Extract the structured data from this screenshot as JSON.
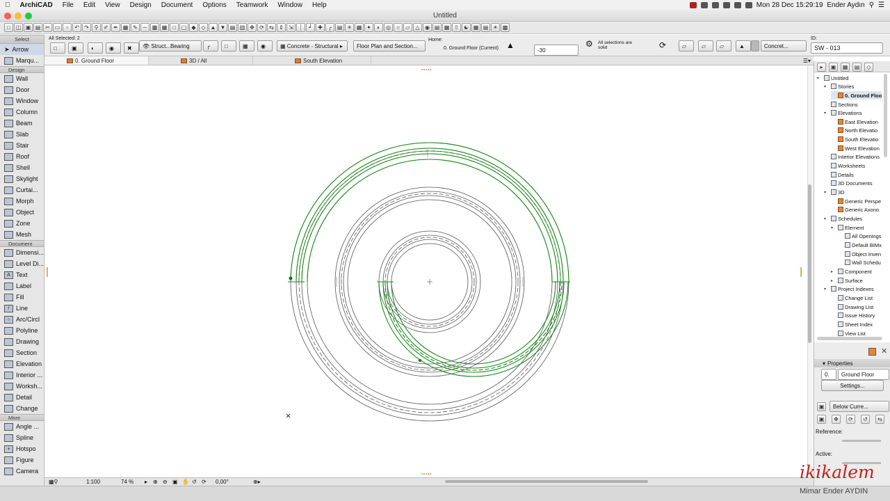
{
  "menubar": {
    "app": "ArchiCAD",
    "items": [
      "File",
      "Edit",
      "View",
      "Design",
      "Document",
      "Options",
      "Teamwork",
      "Window",
      "Help"
    ],
    "datetime": "Mon 28 Dec  15:29:19",
    "user": "Ender Aydın"
  },
  "window": {
    "title": "Untitled"
  },
  "infobox": {
    "selection": "All Selected: 2",
    "structure": "Struct...Bearing",
    "material": "Concrete - Structural",
    "display": "Floor Plan and Section...",
    "home_label": "Home:",
    "home_story": "0. Ground Floor (Current)",
    "offset": "-30",
    "solid_note": "All selections are solid",
    "fill_name": "Concret...",
    "id_label": "ID:",
    "id_value": "SW - 013"
  },
  "tabs": [
    "0. Ground Floor",
    "3D / All",
    "South Elevation"
  ],
  "toolbox": {
    "select_header": "Select",
    "select_tools": [
      "Arrow",
      "Marqu..."
    ],
    "design_header": "Design",
    "design_tools": [
      "Wall",
      "Door",
      "Window",
      "Column",
      "Beam",
      "Slab",
      "Stair",
      "Roof",
      "Shell",
      "Skylight",
      "Curtai...",
      "Morph",
      "Object",
      "Zone",
      "Mesh"
    ],
    "document_header": "Document",
    "document_tools": [
      "Dimensi...",
      "Level Di...",
      "Text",
      "Label",
      "Fill",
      "Line",
      "Arc/Circl",
      "Polyline",
      "Drawing",
      "Section",
      "Elevation",
      "Interior ...",
      "Worksh...",
      "Detail",
      "Change"
    ],
    "more_header": "More",
    "more_tools": [
      "Angle ...",
      "Spline",
      "Hotspo",
      "Figure",
      "Camera"
    ]
  },
  "statusbar": {
    "scale": "1:100",
    "zoom": "74 %",
    "angle": "0,00°"
  },
  "navigator": {
    "root": "Untitled",
    "stories": "Stories",
    "ground_floor": "0. Ground Floo",
    "sections": "Sections",
    "elevations": "Elevations",
    "elevation_items": [
      "East Elevation",
      "North Elevatio",
      "South Elevatio",
      "West Elevation"
    ],
    "interior_elevations": "Interior Elevations",
    "worksheets": "Worksheets",
    "details": "Details",
    "documents_3d": "3D Documents",
    "threed": "3D",
    "threed_items": [
      "Generic Perspe",
      "Generic Axono"
    ],
    "schedules": "Schedules",
    "element": "Element",
    "element_items": [
      "All Openings",
      "Default BIMx",
      "Object Inven",
      "Wall Schedu"
    ],
    "component": "Component",
    "surface": "Surface",
    "project_indexes": "Project Indexes",
    "index_items": [
      "Change List",
      "Drawing List",
      "Issue History",
      "Sheet Index",
      "View List"
    ]
  },
  "properties": {
    "header": "Properties",
    "story_num": "0.",
    "story_name": "Ground Floor",
    "settings": "Settings...",
    "below": "Below Curre...",
    "reference": "Reference:",
    "active": "Active:"
  },
  "watermark": {
    "brand": "ikikalem",
    "name": "Mimar Ender AYDIN"
  },
  "colors": {
    "selection": "#1a8a1a",
    "wall": "#555555",
    "accent": "#d77f3a"
  }
}
